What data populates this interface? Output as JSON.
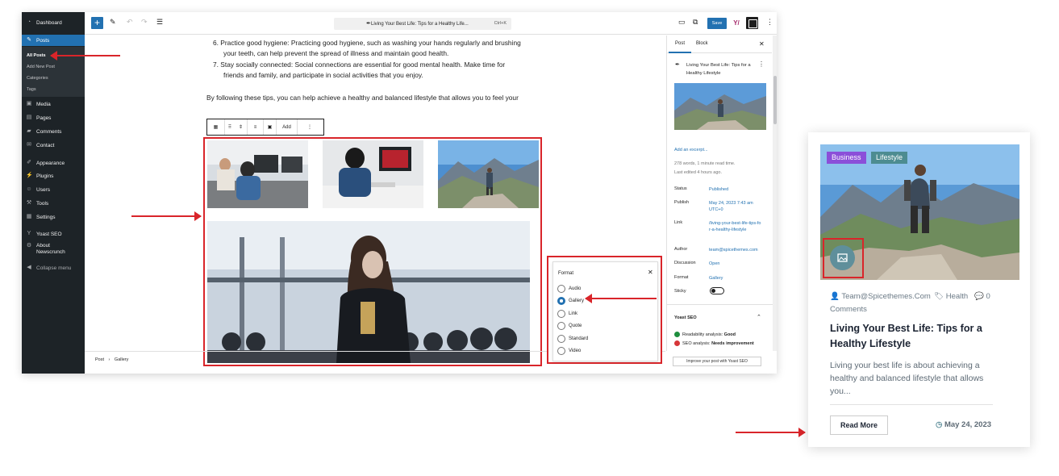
{
  "sidebar": {
    "items": [
      {
        "label": "Dashboard",
        "icon": "dashboard-icon"
      },
      {
        "label": "Posts",
        "icon": "pin-icon"
      },
      {
        "label": "Media",
        "icon": "media-icon"
      },
      {
        "label": "Pages",
        "icon": "pages-icon"
      },
      {
        "label": "Comments",
        "icon": "comments-icon"
      },
      {
        "label": "Contact",
        "icon": "contact-icon"
      },
      {
        "label": "Appearance",
        "icon": "brush-icon"
      },
      {
        "label": "Plugins",
        "icon": "plugin-icon"
      },
      {
        "label": "Users",
        "icon": "users-icon"
      },
      {
        "label": "Tools",
        "icon": "wrench-icon"
      },
      {
        "label": "Settings",
        "icon": "settings-icon"
      },
      {
        "label": "Yoast SEO",
        "icon": "yoast-icon"
      },
      {
        "label": "About",
        "icon": "gear-icon"
      },
      {
        "label": "Newscrunch",
        "icon": ""
      },
      {
        "label": "Collapse menu",
        "icon": "collapse-icon"
      }
    ],
    "posts_submenu": [
      "All Posts",
      "Add New Post",
      "Categories",
      "Tags"
    ]
  },
  "topbar": {
    "doc_title": "Living Your Best Life: Tips for a Healthy Life...",
    "shortcut": "Ctrl+K",
    "save_label": "Save",
    "yoast_label": "Y/"
  },
  "content": {
    "list_item_6": "6. Practice good hygiene: Practicing good hygiene, such as washing your hands regularly and brushing",
    "list_item_6b": "your teeth, can help prevent the spread of illness and maintain good health.",
    "list_item_7": "7. Stay socially connected: Social connections are essential for good mental health. Make time for",
    "list_item_7b": "friends and family, and participate in social activities that you enjoy.",
    "closing": "By following these tips, you can help achieve a healthy and balanced lifestyle that allows you to feel your",
    "toolbar_add": "Add"
  },
  "statusbar": {
    "path_1": "Post",
    "path_2": "Gallery"
  },
  "settings": {
    "tab_post": "Post",
    "tab_block": "Block",
    "post_title": "Living Your Best Life: Tips for a Healthy Lifestyle",
    "excerpt_link": "Add an excerpt...",
    "stats": "278 words, 1 minute read time.",
    "last_edited": "Last edited 4 hours ago.",
    "rows": [
      {
        "label": "Status",
        "value": "Published"
      },
      {
        "label": "Publish",
        "value": "May 24, 2023 7:43 am UTC+0"
      },
      {
        "label": "Link",
        "value": "/living-your-best-life-tips-for-a-healthy-lifestyle"
      },
      {
        "label": "Author",
        "value": "team@spicethemes.com"
      },
      {
        "label": "Discussion",
        "value": "Open"
      },
      {
        "label": "Format",
        "value": "Gallery"
      },
      {
        "label": "Sticky",
        "value": ""
      }
    ],
    "yoast_title": "Yoast SEO",
    "readability_label": "Readability analysis:",
    "readability_value": "Good",
    "seo_label": "SEO analysis:",
    "seo_value": "Needs improvement",
    "improve_btn": "Improve your post with Yoast SEO"
  },
  "format_popover": {
    "title": "Format",
    "options": [
      "Audio",
      "Gallery",
      "Link",
      "Quote",
      "Standard",
      "Video"
    ],
    "selected": "Gallery"
  },
  "card": {
    "badges": [
      {
        "label": "Business",
        "color": "#8b4fd9"
      },
      {
        "label": "Lifestyle",
        "color": "#4d8c91"
      }
    ],
    "author": "Team@Spicethemes.Com",
    "category": "Health",
    "comments_count": "0",
    "comments_word": "Comments",
    "title": "Living Your Best Life: Tips for a Healthy Lifestyle",
    "excerpt": "Living your best life is about achieving a healthy and balanced lifestyle that allows you...",
    "read_more": "Read More",
    "date": "May 24, 2023"
  },
  "colors": {
    "wp_blue": "#2271b1",
    "wp_dark": "#1d2327",
    "annotation_red": "#d9252a",
    "accent_teal": "#5f8f9b"
  }
}
